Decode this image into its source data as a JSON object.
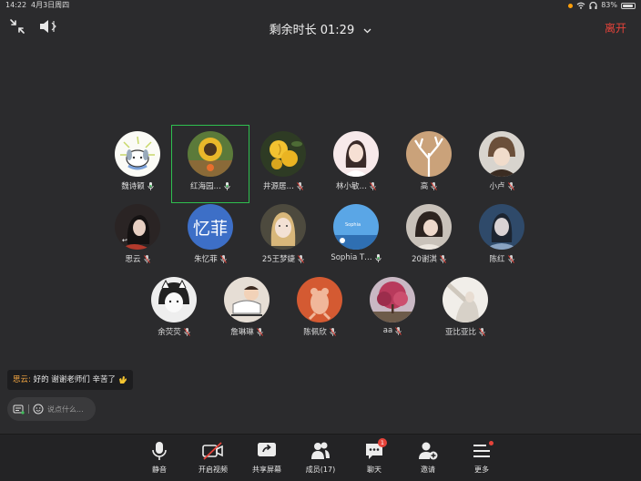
{
  "status_bar": {
    "time": "14:22",
    "date": "4月3日周四",
    "battery": "83%"
  },
  "header": {
    "timer": "剩余时长 01:29",
    "leave_label": "离开"
  },
  "participants": [
    {
      "name": "魏诗颖",
      "mic": "on",
      "avatar": "cartoon-dog"
    },
    {
      "name": "红海园…",
      "mic": "on",
      "avatar": "sunflower",
      "active": true
    },
    {
      "name": "井源居…",
      "mic": "off",
      "avatar": "yellow-rose"
    },
    {
      "name": "林小敏…",
      "mic": "off",
      "avatar": "drawn-girl"
    },
    {
      "name": "高",
      "mic": "off",
      "avatar": "tree"
    },
    {
      "name": "小卢",
      "mic": "off",
      "avatar": "winter-hat-girl"
    },
    {
      "name": "思云",
      "mic": "off",
      "avatar": "dark-girl"
    },
    {
      "name": "朱忆菲",
      "mic": "off",
      "avatar": "text-avatar",
      "avatar_text": "忆菲"
    },
    {
      "name": "25王梦婕",
      "mic": "off",
      "avatar": "blonde-girl"
    },
    {
      "name": "Sophia T…",
      "mic": "on",
      "avatar": "blue-sky"
    },
    {
      "name": "20谢淇",
      "mic": "off",
      "avatar": "bob-hair-girl"
    },
    {
      "name": "陈红",
      "mic": "off",
      "avatar": "blue-portrait"
    },
    {
      "name": "余荧荧",
      "mic": "off",
      "avatar": "bw-girl"
    },
    {
      "name": "詹琳琳",
      "mic": "off",
      "avatar": "cartoon-kid"
    },
    {
      "name": "陈佩欣",
      "mic": "off",
      "avatar": "orange-bear"
    },
    {
      "name": "aa",
      "mic": "off",
      "avatar": "pink-tree"
    },
    {
      "name": "亚比亚比",
      "mic": "off",
      "avatar": "white-room"
    }
  ],
  "chat": {
    "sender": "思云:",
    "message": "好的 谢谢老师们 辛苦了",
    "input_placeholder": "说点什么..."
  },
  "toolbar": {
    "mute": "静音",
    "video": "开启视频",
    "share": "共享屏幕",
    "members": "成员(17)",
    "chat": "聊天",
    "chat_badge": "1",
    "invite": "邀请",
    "more": "更多"
  },
  "colors": {
    "active_border": "#2fbf4f",
    "leave": "#e6433a",
    "text_avatar_bg": "#3d6fc7",
    "sender": "#f2a541"
  }
}
